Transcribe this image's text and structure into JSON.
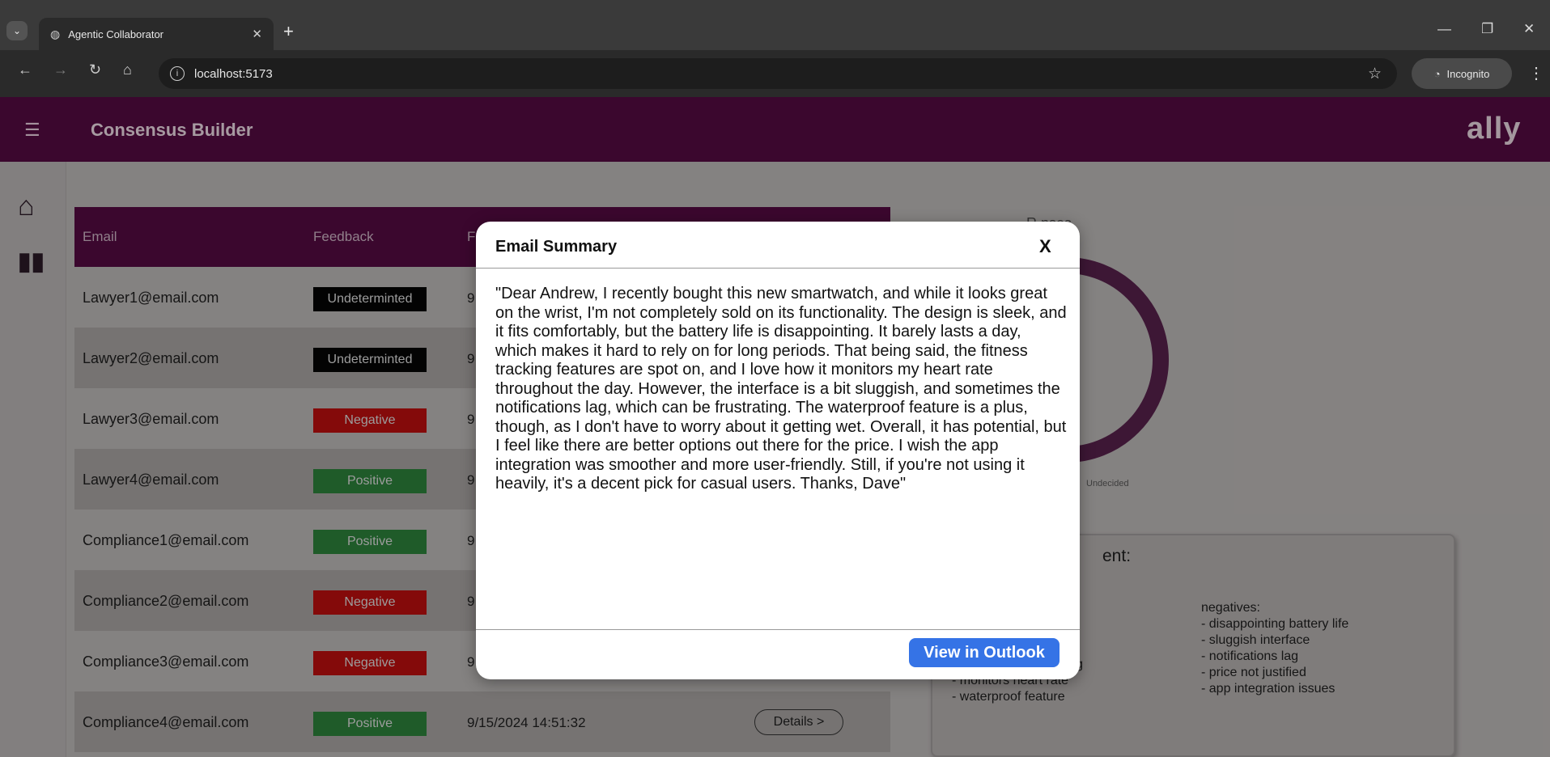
{
  "browser": {
    "tab_title": "Agentic Collaborator",
    "url": "localhost:5173",
    "incognito_label": "Incognito"
  },
  "app": {
    "title": "Consensus Builder",
    "brand": "ally",
    "brand_color": "#520a40"
  },
  "table": {
    "headers": {
      "email": "Email",
      "feedback": "Feedback",
      "time": "F"
    },
    "rows": [
      {
        "email": "Lawyer1@email.com",
        "feedback": "Undeterminted",
        "ts": "9"
      },
      {
        "email": "Lawyer2@email.com",
        "feedback": "Undeterminted",
        "ts": "9"
      },
      {
        "email": "Lawyer3@email.com",
        "feedback": "Negative",
        "ts": "9"
      },
      {
        "email": "Lawyer4@email.com",
        "feedback": "Positive",
        "ts": "9"
      },
      {
        "email": "Compliance1@email.com",
        "feedback": "Positive",
        "ts": "9"
      },
      {
        "email": "Compliance2@email.com",
        "feedback": "Negative",
        "ts": "9"
      },
      {
        "email": "Compliance3@email.com",
        "feedback": "Negative",
        "ts": "9"
      },
      {
        "email": "Compliance4@email.com",
        "feedback": "Positive",
        "ts": "9/15/2024 14:51:32"
      }
    ],
    "details_label": "Details >"
  },
  "responses": {
    "title": "R    nses",
    "legend_undecided": "Undecided"
  },
  "sentiment": {
    "title": "ent:",
    "positives_partial": [
      "tracking",
      "- monitors heart rate",
      "- waterproof feature"
    ],
    "negatives_label": "negatives:",
    "negatives": [
      "- disappointing battery life",
      "- sluggish interface",
      "- notifications lag",
      "- price not justified",
      "- app integration issues"
    ]
  },
  "modal": {
    "title": "Email Summary",
    "close_label": "X",
    "body": "\"Dear Andrew, I recently bought this new smartwatch, and while it looks great on the wrist, I'm not completely sold on its functionality. The design is sleek, and it fits comfortably, but the battery life is disappointing. It barely lasts a day, which makes it hard to rely on for long periods. That being said, the fitness tracking features are spot on, and I love how it monitors my heart rate throughout the day. However, the interface is a bit sluggish, and sometimes the notifications lag, which can be frustrating. The waterproof feature is a plus, though, as I don't have to worry about it getting wet. Overall, it has potential, but I feel like there are better options out there for the price. I wish the app integration was smoother and more user-friendly. Still, if you're not using it heavily, it's a decent pick for casual users. Thanks, Dave\"",
    "action_label": "View in Outlook"
  }
}
